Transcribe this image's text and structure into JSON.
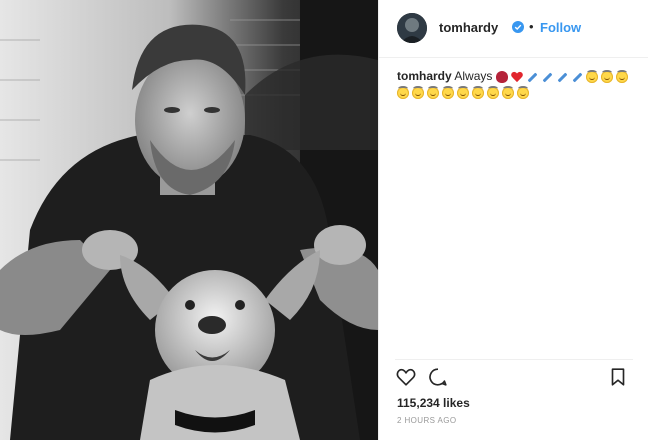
{
  "post": {
    "username": "tomhardy",
    "follow_label": "Follow",
    "caption_text": "Always",
    "likes": "115,234 likes",
    "timestamp": "2 HOURS AGO"
  },
  "icons": {
    "like": "heart-icon",
    "comment": "comment-icon",
    "save": "bookmark-icon",
    "verified": "verified-badge-icon"
  },
  "emojis": {
    "line1": [
      "rose",
      "heart",
      "syringe",
      "syringe",
      "syringe",
      "syringe",
      "smile",
      "smile",
      "smile"
    ],
    "line2": [
      "smile",
      "smile",
      "smile",
      "smile",
      "smile",
      "smile",
      "smile",
      "smile",
      "smile"
    ]
  },
  "colors": {
    "link_blue": "#3897f0",
    "text": "#262626",
    "muted": "#999999",
    "border": "#efefef"
  }
}
